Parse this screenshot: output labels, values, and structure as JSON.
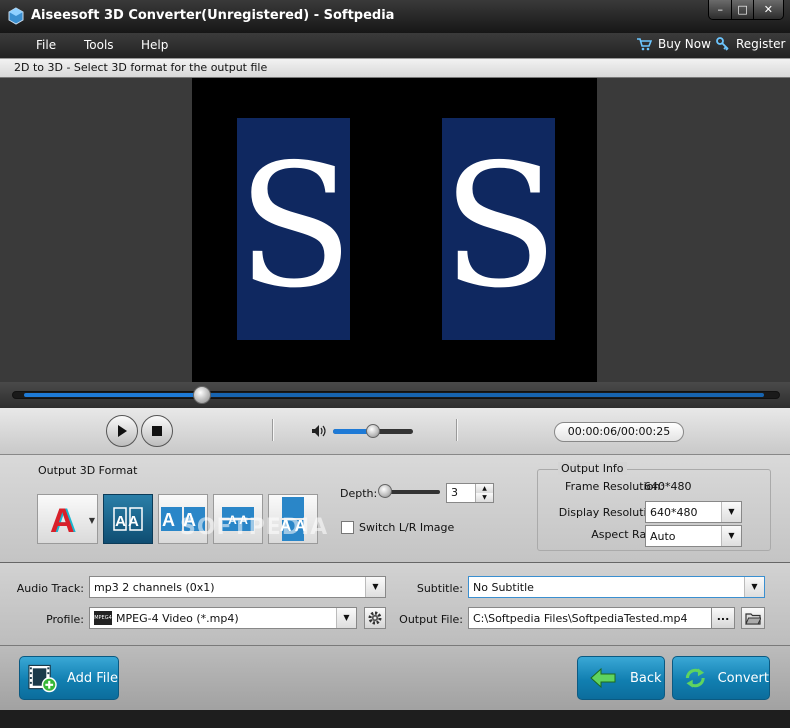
{
  "window": {
    "title": "Aiseesoft 3D Converter(Unregistered) - Softpedia",
    "controls": {
      "minimize": "–",
      "maximize": "□",
      "close": "✕"
    }
  },
  "menu": {
    "items": [
      "File",
      "Tools",
      "Help"
    ],
    "buy_now": "Buy Now",
    "register": "Register"
  },
  "hint": "2D to 3D - Select 3D format for the output file",
  "preview": {
    "glyph_left": "S",
    "glyph_right": "S"
  },
  "playback": {
    "seek_fraction": 0.24,
    "volume_fraction": 0.5,
    "time": "00:00:06/00:00:25"
  },
  "format3d": {
    "label": "Output 3D Format",
    "buttons": [
      {
        "name": "anaglyph",
        "text": "A"
      },
      {
        "name": "side-by-side-half",
        "text": "AA",
        "selected": true
      },
      {
        "name": "side-by-side-full",
        "text": "AA"
      },
      {
        "name": "top-bottom-half",
        "text": "A A"
      },
      {
        "name": "top-bottom-full",
        "text": "A A"
      }
    ],
    "depth_label": "Depth:",
    "depth_value": "3",
    "switch_label": "Switch L/R Image",
    "switch_checked": false,
    "watermark": "SOFTPEDIA"
  },
  "output_info": {
    "title": "Output Info",
    "frame_resolution_label": "Frame Resolution:",
    "frame_resolution": "640*480",
    "display_resolution_label": "Display Resolution:",
    "display_resolution": "640*480",
    "aspect_ratio_label": "Aspect Ratio:",
    "aspect_ratio": "Auto"
  },
  "settings": {
    "audio_track_label": "Audio Track:",
    "audio_track": "mp3 2 channels (0x1)",
    "subtitle_label": "Subtitle:",
    "subtitle": "No Subtitle",
    "profile_label": "Profile:",
    "profile": "MPEG-4 Video (*.mp4)",
    "profile_badge": "MPEG4",
    "output_file_label": "Output File:",
    "output_file": "C:\\Softpedia Files\\SoftpediaTested.mp4",
    "browse": "..."
  },
  "actions": {
    "add_file": "Add File",
    "back": "Back",
    "convert": "Convert"
  },
  "colors": {
    "accent": "#1e7ad6",
    "button_blue": "#117fb1",
    "dark_bg": "#2a2a2a"
  }
}
